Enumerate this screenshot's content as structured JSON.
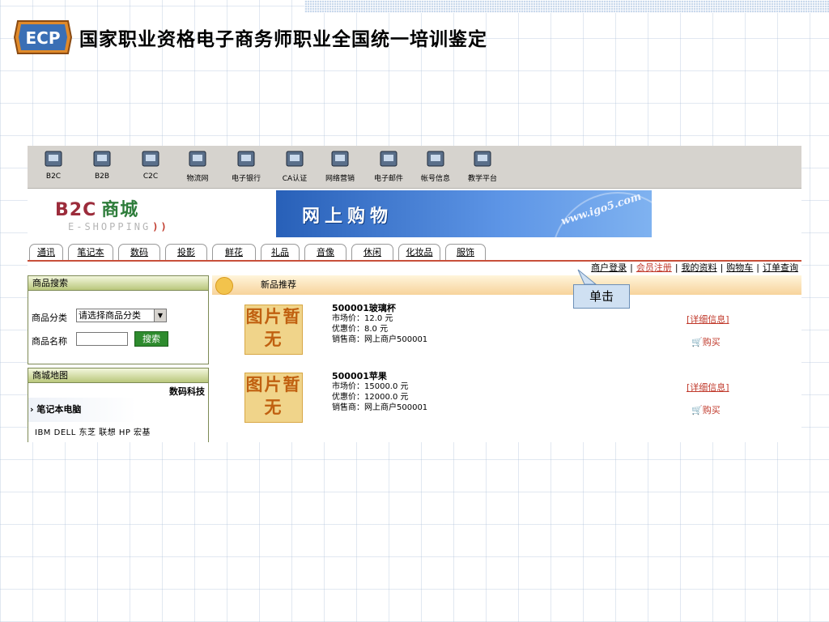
{
  "slide": {
    "logo_text": "ECP",
    "title": "国家职业资格电子商务师职业全国统一培训鉴定"
  },
  "top_nav": [
    {
      "label": "B2C",
      "icon": "b2c-icon"
    },
    {
      "label": "B2B",
      "icon": "b2b-icon"
    },
    {
      "label": "C2C",
      "icon": "c2c-icon"
    },
    {
      "label": "物流网",
      "icon": "logistics-icon"
    },
    {
      "label": "电子银行",
      "icon": "e-bank-icon"
    },
    {
      "label": "CA认证",
      "icon": "ca-cert-icon"
    },
    {
      "label": "网络营销",
      "icon": "network-marketing-icon"
    },
    {
      "label": "电子邮件",
      "icon": "email-icon"
    },
    {
      "label": "帐号信息",
      "icon": "account-info-icon"
    },
    {
      "label": "教学平台",
      "icon": "teaching-platform-icon"
    }
  ],
  "store_logo": {
    "brand": "B2C",
    "name": "商城",
    "sub": "E-SHOPPING"
  },
  "banner": {
    "text": "网上购物",
    "url": "www.igo5.com"
  },
  "categories": [
    "通讯",
    "笔记本",
    "数码",
    "投影",
    "鲜花",
    "礼品",
    "音像",
    "休闲",
    "化妆品",
    "服饰"
  ],
  "user_links": {
    "login": "商户登录",
    "register": "会员注册",
    "profile": "我的资料",
    "cart": "购物车",
    "orders": "订单查询",
    "separator": "|"
  },
  "search": {
    "title": "商品搜索",
    "category_label": "商品分类",
    "category_value": "请选择商品分类",
    "name_label": "商品名称",
    "name_value": "",
    "button": "搜索"
  },
  "mall_map": {
    "title": "商城地图",
    "subtitle": "数码科技",
    "category": "笔记本电脑",
    "brands": "IBM DELL 东芝 联想 HP 宏基"
  },
  "new_products": {
    "title": "新品推荐",
    "items": [
      {
        "image_text": "图片暂无",
        "name": "500001玻璃杯",
        "market_price": "市场价：12.0 元",
        "sale_price": "优惠价：8.0 元",
        "seller": "销售商：网上商户500001",
        "detail_link": "[详细信息]",
        "buy_link": "购买"
      },
      {
        "image_text": "图片暂无",
        "name": "500001苹果",
        "market_price": "市场价：15000.0 元",
        "sale_price": "优惠价：12000.0 元",
        "seller": "销售商：网上商户500001",
        "detail_link": "[详细信息]",
        "buy_link": "购买"
      }
    ]
  },
  "callout": {
    "text": "单击"
  }
}
